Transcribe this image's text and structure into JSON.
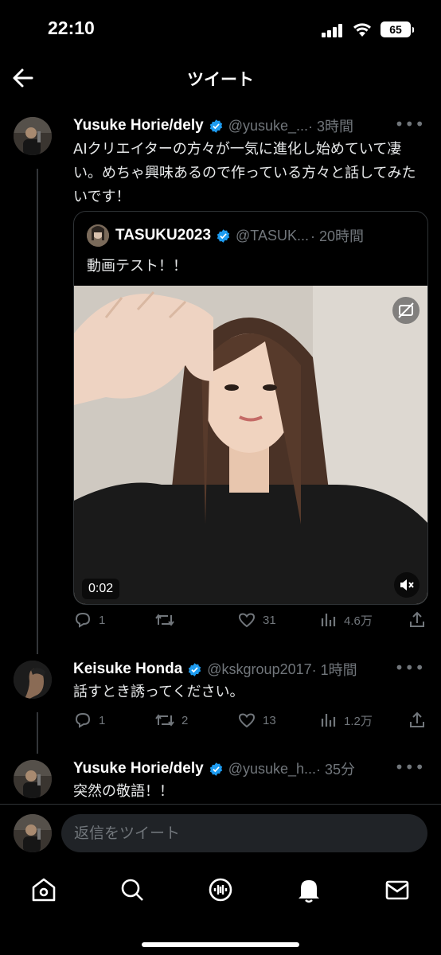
{
  "status_bar": {
    "time": "22:10",
    "battery": "65"
  },
  "header": {
    "title": "ツイート"
  },
  "tweets": [
    {
      "name": "Yusuke Horie/dely",
      "handle": "@yusuke_...",
      "time": "· 3時間",
      "text": "AIクリエイターの方々が一気に進化し始めていて凄い。めちゃ興味あるので作っている方々と話してみたいです！",
      "quote": {
        "name": "TASUKU2023",
        "handle": "@TASUK...",
        "time": "· 20時間",
        "text": "動画テスト！！",
        "video_time": "0:02"
      },
      "actions": {
        "replies": "1",
        "retweets": "",
        "likes": "31",
        "views": "4.6万"
      }
    },
    {
      "name": "Keisuke Honda",
      "handle": "@kskgroup2017",
      "time": "· 1時間",
      "text": "話すとき誘ってください。",
      "actions": {
        "replies": "1",
        "retweets": "2",
        "likes": "13",
        "views": "1.2万"
      }
    },
    {
      "name": "Yusuke Horie/dely",
      "handle": "@yusuke_h...",
      "time": "· 35分",
      "text": "突然の敬語！！"
    }
  ],
  "reply": {
    "placeholder": "返信をツイート"
  },
  "colors": {
    "accent": "#1d9bf0",
    "muted": "#71767b",
    "background": "#000000"
  },
  "icons": [
    "back-arrow-icon",
    "verified-icon",
    "more-icon",
    "reply-icon",
    "retweet-icon",
    "like-icon",
    "views-icon",
    "share-icon",
    "home-icon",
    "search-icon",
    "spaces-icon",
    "bell-icon",
    "mail-icon"
  ]
}
